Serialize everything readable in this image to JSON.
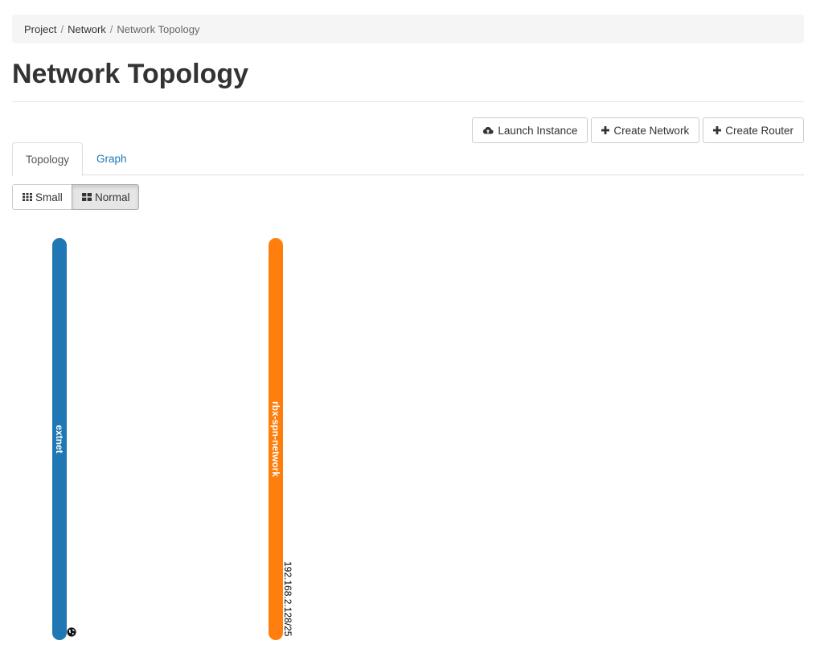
{
  "breadcrumb": {
    "items": [
      "Project",
      "Network",
      "Network Topology"
    ],
    "separator": "/"
  },
  "page": {
    "title": "Network Topology"
  },
  "actions": {
    "launch_instance": "Launch Instance",
    "create_network": "Create Network",
    "create_router": "Create Router"
  },
  "tabs": [
    {
      "label": "Topology",
      "active": true
    },
    {
      "label": "Graph",
      "active": false
    }
  ],
  "size_toggle": {
    "small": "Small",
    "normal": "Normal",
    "selected": "Normal"
  },
  "networks": [
    {
      "name": "extnet",
      "color": "#1f77b4",
      "external": true,
      "icon": "globe-icon",
      "subnets": []
    },
    {
      "name": "rbx-spn-network",
      "color": "#ff7f0e",
      "external": false,
      "subnets": [
        "192.168.2.128/25"
      ]
    }
  ],
  "colors": {
    "link": "#1f77b4",
    "breadcrumb_bg": "#f5f5f5"
  }
}
